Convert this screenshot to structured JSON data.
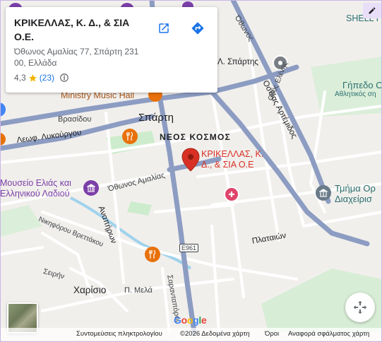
{
  "place_card": {
    "title": "ΚΡΙΚΕΛΛΑΣ, Κ. Δ., & ΣΙΑ Ο.Ε.",
    "address": "Όθωνος Αμαλίας 77, Σπάρτη 231 00, Ελλάδα",
    "rating": "4,3",
    "review_count": "(23)",
    "open_icon": "open-in-new-icon",
    "directions_icon": "directions-icon",
    "info_icon": "info-icon",
    "star_color": "#f4b400"
  },
  "map": {
    "marker_label": "ΚΡΙΚΕΛΛΑΣ, Κ. Δ., & ΣΙΑ Ο.Ε",
    "marker_color": "#d93025",
    "labels": {
      "shell_top": "SHELL Ι",
      "othonos_top": "Όθωνος",
      "l_spartis": "Λ. Σπάρτης",
      "gipedo": "Γήπεδο Ο",
      "athletic": "Αθλητικός ση",
      "ministry": "Ministry Music Hall",
      "sparti": "Σπάρτη",
      "vrasidou": "Βρασίδου",
      "neos_kosmos": "ΝΕΟΣ ΚΟΣΜΟΣ",
      "lykourgou": "Λεωφ. Λυκούργου",
      "othias_artemidos": "Οσθίας Αρτέμιδος",
      "odos_elenis": "Οδός Ελένης",
      "mouseio_1": "Μουσείο Ελιάς και",
      "mouseio_2": "Ελληνικού Λαδιού",
      "othonos_amalias": "Όθωνος Αμαλίας",
      "tmima_1": "Τμήμα Ορ",
      "tmima_2": "Διαχείρισ",
      "anapiron": "Αναπήρων",
      "nikiforou": "Νικηφόρου Βρεττάκου",
      "e961": "E961",
      "plataion": "Πλαταιών",
      "seirion": "Σειρήν",
      "charisio": "Χαρίσιο",
      "p_mela": "Π. Μελά",
      "sarantaporou": "Σαρανταπόρου"
    },
    "colors": {
      "background": "#f1efec",
      "main_road": "#8c9cc2",
      "minor_road": "#ffffff",
      "park": "#cdeccd",
      "water": "#9fd2ec"
    }
  },
  "controls": {
    "edit_icon": "pencil-icon",
    "recenter_icon": "fullscreen-icon",
    "thumbnail_icon": "satellite-thumbnail"
  },
  "footer": {
    "google_logo": "Google",
    "shortcuts": "Συντομεύσεις πληκτρολογίου",
    "copyright": "©2026 Δεδομένα χάρτη",
    "terms": "Όροι",
    "report": "Αναφορά σφάλματος χάρτη"
  }
}
